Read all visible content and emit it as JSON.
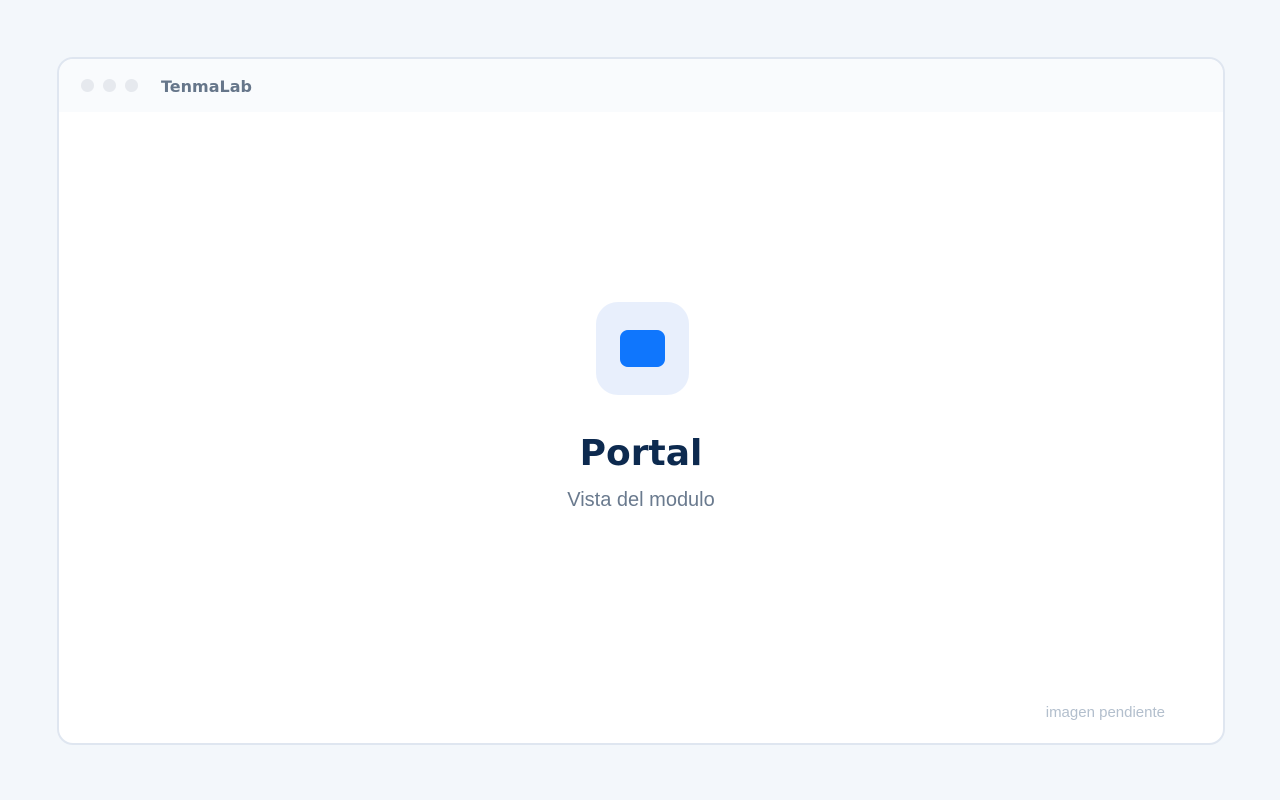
{
  "window": {
    "title": "TenmaLab"
  },
  "main": {
    "icon": "app-module-icon",
    "title": "Portal",
    "subtitle": "Vista del modulo",
    "footnote": "imagen pendiente"
  },
  "colors": {
    "accent": "#0f76fd",
    "tile": "#e8effc",
    "heading": "#0d2a4f",
    "muted": "#6a7a8e"
  }
}
